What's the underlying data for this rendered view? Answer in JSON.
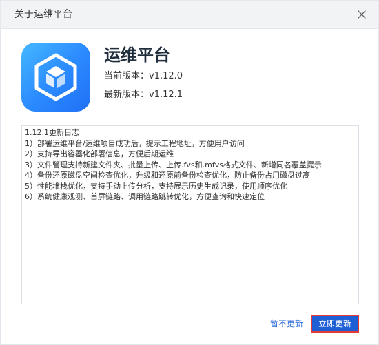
{
  "dialog": {
    "title": "关于运维平台",
    "close_icon": "close-icon"
  },
  "app": {
    "icon": "cube-logo-icon",
    "name": "运维平台",
    "current_version": "当前版本：v1.12.0",
    "latest_version": "最新版本：v1.12.1"
  },
  "changelog": {
    "lines": [
      "1.12.1更新日志",
      "1）部署运维平台/运维项目成功后，提示工程地址，方便用户访问",
      "2）支持导出容器化部署信息，方便后期运维",
      "3）文件管理支持新建文件夹、批量上传、上传.fvs和.mfvs格式文件、新增同名覆盖提示",
      "4）备份还原磁盘空间检查优化，升级和还原前备份检查优化，防止备份占用磁盘过高",
      "5）性能堆栈优化，支持手动上传分析，支持展示历史生成记录，使用顺序优化",
      "6）系统健康观测、首屏链路、调用链路跳转优化，方便查询和快速定位"
    ]
  },
  "footer": {
    "skip_label": "暂不更新",
    "update_label": "立即更新"
  },
  "colors": {
    "primary": "#1f5fd6",
    "link": "#2d6bd8",
    "highlight_border": "#e53935",
    "icon_gradient_start": "#45b8ff",
    "icon_gradient_end": "#1f6ff5"
  }
}
